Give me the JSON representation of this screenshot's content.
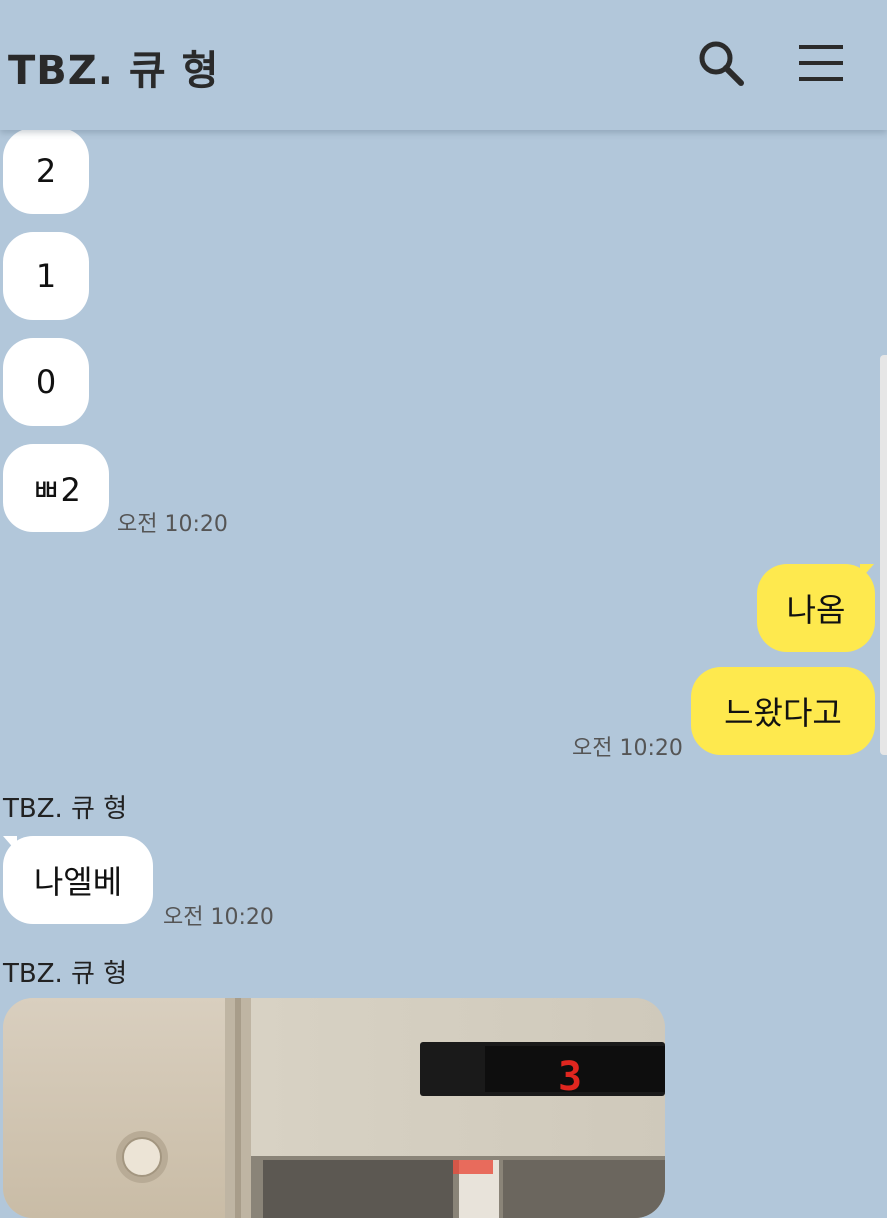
{
  "header": {
    "title": "TBZ. 큐 형",
    "search_icon": "search-icon",
    "menu_icon": "hamburger-menu-icon"
  },
  "messages": {
    "countdown": [
      "2",
      "1",
      "0",
      "ㅃ2"
    ],
    "time_1": "오전 10:20",
    "mine_1": "나옴",
    "mine_2": "느왔다고",
    "time_2": "오전 10:20",
    "sender_1": "TBZ. 큐 형",
    "reply": "나엘베",
    "time_3": "오전 10:20",
    "sender_2": "TBZ. 큐 형",
    "photo": {
      "elevator_floor_display": "3"
    }
  },
  "colors": {
    "background": "#b2c7da",
    "my_bubble": "#fee94e",
    "their_bubble": "#ffffff",
    "floor_digit": "#e0261f"
  }
}
